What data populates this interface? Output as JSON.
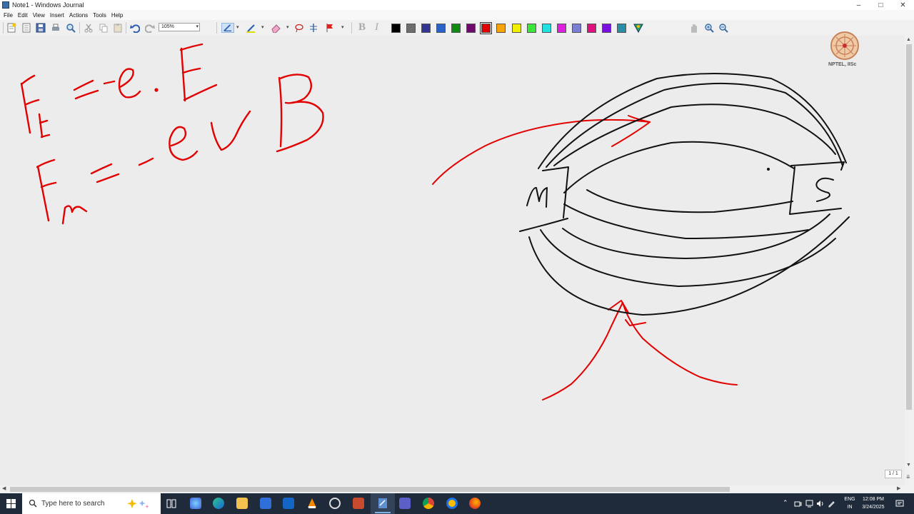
{
  "window": {
    "title": "Note1 - Windows Journal",
    "controls": [
      "–",
      "□",
      "✕"
    ]
  },
  "menu": [
    "File",
    "Edit",
    "View",
    "Insert",
    "Actions",
    "Tools",
    "Help"
  ],
  "toolbar": {
    "zoom_value": "105%",
    "bold_label": "B",
    "italic_label": "I",
    "swatches": [
      "#000000",
      "#6d6d6d",
      "#343493",
      "#2a62c9",
      "#118a11",
      "#6e0a6e",
      "#e00000",
      "#f7a400",
      "#f0f000",
      "#38e638",
      "#22e0e0",
      "#e01ee0",
      "#7a7fd1",
      "#e0107f",
      "#7a10e0",
      "#2a8fa6"
    ],
    "selected_swatch_index": 6
  },
  "logo": {
    "text": "NPTEL, IISc"
  },
  "page": {
    "indicator": "1 / 1"
  },
  "taskbar": {
    "search_placeholder": "Type here to search",
    "lang_top": "ENG",
    "lang_bottom": "IN",
    "time": "12:08 PM",
    "date": "3/24/2025"
  }
}
